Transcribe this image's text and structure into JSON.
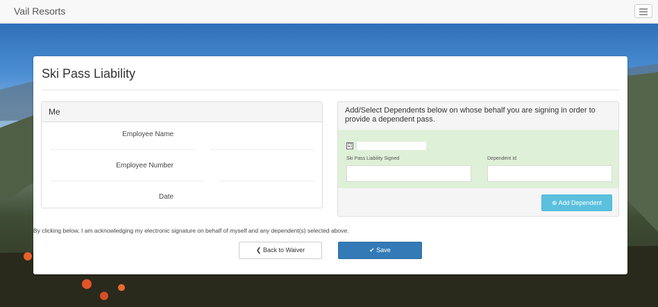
{
  "navbar": {
    "brand": "Vail Resorts",
    "menu_icon": "hamburger-icon"
  },
  "panel": {
    "title": "Ski Pass Liability"
  },
  "me": {
    "heading": "Me",
    "fields": [
      {
        "label": "Employee Name",
        "value": ""
      },
      {
        "label": "Employee Number",
        "value": ""
      },
      {
        "label": "Date",
        "value": ""
      }
    ]
  },
  "dependents": {
    "heading": "Add/Select Dependents below on whose behalf you are signing in order to provide a dependent pass.",
    "checkbox_mark": "☑",
    "signed_label": "Ski Pass Liability Signed",
    "signed_value": "",
    "id_label": "Dependent Id",
    "id_value": "",
    "add_button": "Add Dependent",
    "add_icon": "plus-circle-icon"
  },
  "acknowledgement": "By clicking below, I am acknowledging my electronic signature on behalf of myself and any dependent(s) selected above.",
  "buttons": {
    "back_label": "Back to Waiver",
    "back_icon": "chevron-left-icon",
    "save_label": "Save",
    "save_icon": "checkmark-icon"
  },
  "colors": {
    "navbar_bg": "#f8f8f8",
    "info_button": "#5bc0de",
    "primary_button": "#337ab7",
    "success_bg": "#dff0d8"
  }
}
